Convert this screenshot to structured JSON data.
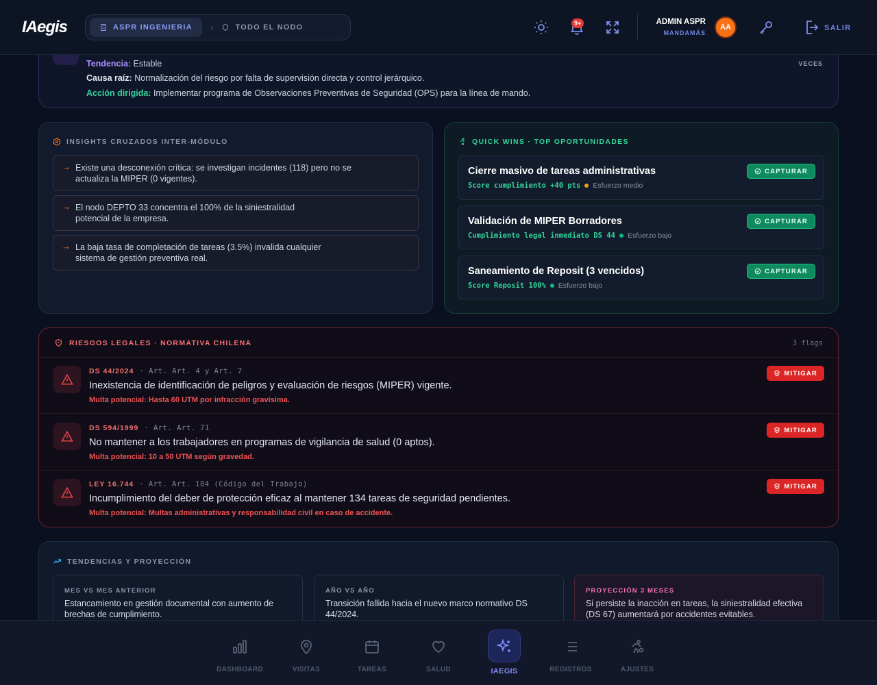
{
  "header": {
    "logo": "IAegis",
    "breadcrumb": [
      "ASPR INGENIERIA",
      "TODO EL NODO"
    ],
    "notifications_badge": "9+",
    "user_name": "ADMIN ASPR",
    "user_role": "MANDAMÁS",
    "avatar_initials": "AA",
    "logout_label": "SALIR"
  },
  "trend_card": {
    "tendencia_label": "Tendencia:",
    "tendencia_value": "Estable",
    "causa_label": "Causa raíz:",
    "causa_value": "Normalización del riesgo por falta de supervisión directa y control jerárquico.",
    "accion_label": "Acción dirigida:",
    "accion_value": "Implementar programa de Observaciones Preventivas de Seguridad (OPS) para la línea de mando.",
    "side_label": "VECES"
  },
  "insights": {
    "title": "INSIGHTS CRUZADOS INTER-MÓDULO",
    "items": [
      {
        "line1": "Existe una desconexión crítica: se investigan incidentes (118) pero no se",
        "line2": "actualiza la MIPER (0 vigentes)."
      },
      {
        "line1": "El nodo DEPTO 33 concentra el 100% de la siniestralidad",
        "line2": "potencial de la empresa."
      },
      {
        "line1": "La baja tasa de completación de tareas (3.5%) invalida cualquier",
        "line2": "sistema de gestión preventiva real."
      }
    ]
  },
  "quick_wins": {
    "title": "QUICK WINS · TOP OPORTUNIDADES",
    "button_label": "CAPTURAR",
    "items": [
      {
        "title": "Cierre masivo de tareas administrativas",
        "score": "Score cumplimiento +40 pts",
        "effort": "Esfuerzo medio",
        "effort_color": "#f59e0b"
      },
      {
        "title": "Validación de MIPER Borradores",
        "score": "Cumplimiento legal inmediato DS 44",
        "effort": "Esfuerzo bajo",
        "effort_color": "#10b981"
      },
      {
        "title": "Saneamiento de Reposit (3 vencidos)",
        "score": "Score Reposit 100%",
        "effort": "Esfuerzo bajo",
        "effort_color": "#10b981"
      }
    ]
  },
  "legal": {
    "title": "RIESGOS LEGALES · NORMATIVA CHILENA",
    "flags": "3 flags",
    "button_label": "MITIGAR",
    "items": [
      {
        "code": "DS 44/2024",
        "art": "· Art. Art. 4 y Art. 7",
        "desc": "Inexistencia de identificación de peligros y evaluación de riesgos (MIPER) vigente.",
        "fine": "Multa potencial: Hasta 60 UTM por infracción gravísima."
      },
      {
        "code": "DS 594/1999",
        "art": "· Art. Art. 71",
        "desc": "No mantener a los trabajadores en programas de vigilancia de salud (0 aptos).",
        "fine": "Multa potencial: 10 a 50 UTM según gravedad."
      },
      {
        "code": "LEY 16.744",
        "art": "· Art. Art. 184 (Código del Trabajo)",
        "desc": "Incumplimiento del deber de protección eficaz al mantener 134 tareas de seguridad pendientes.",
        "fine": "Multa potencial: Multas administrativas y responsabilidad civil en caso de accidente."
      }
    ]
  },
  "trends": {
    "title": "TENDENCIAS Y PROYECCIÓN",
    "cols": [
      {
        "title": "MES VS MES ANTERIOR",
        "line1": "Estancamiento en gestión documental con aumento de",
        "line2": "brechas de cumplimiento."
      },
      {
        "title": "AÑO VS AÑO",
        "line1": "Transición fallida hacia el nuevo marco normativo DS",
        "line2": "44/2024."
      },
      {
        "title": "PROYECCIÓN 3 MESES",
        "line1": "Si persiste la inacción en tareas, la siniestralidad efectiva",
        "line2": "(DS 67) aumentará por accidentes evitables."
      }
    ]
  },
  "nav": {
    "items": [
      "DASHBOARD",
      "VISITAS",
      "TAREAS",
      "SALUD",
      "IAEGIS",
      "REGISTROS",
      "AJUSTES"
    ],
    "active": "IAEGIS"
  },
  "colors": {
    "accent": "#6f86e6",
    "success": "#10b981",
    "danger": "#dc2626",
    "warning": "#f97316"
  }
}
